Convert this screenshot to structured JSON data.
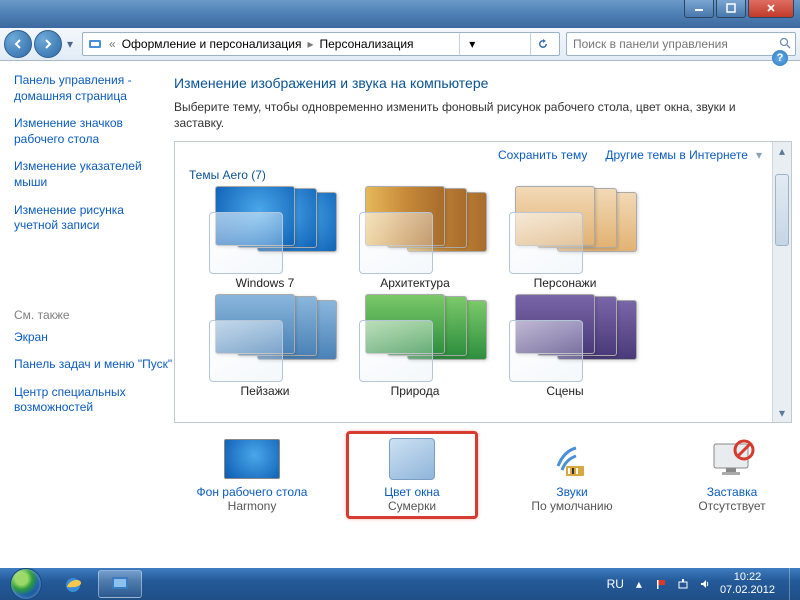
{
  "breadcrumb": {
    "parent": "Оформление и персонализация",
    "current": "Персонализация"
  },
  "search": {
    "placeholder": "Поиск в панели управления"
  },
  "sidebar": {
    "links": [
      "Панель управления - домашняя страница",
      "Изменение значков рабочего стола",
      "Изменение указателей мыши",
      "Изменение рисунка учетной записи"
    ],
    "see_also": "См. также",
    "bottom": [
      "Экран",
      "Панель задач и меню \"Пуск\"",
      "Центр специальных возможностей"
    ]
  },
  "page": {
    "title": "Изменение изображения и звука на компьютере",
    "subtitle": "Выберите тему, чтобы одновременно изменить фоновый рисунок рабочего стола, цвет окна, звуки и заставку."
  },
  "themes_header": {
    "save": "Сохранить тему",
    "online": "Другие темы в Интернете"
  },
  "group_label": "Темы Aero (7)",
  "themes": [
    {
      "name": "Windows 7"
    },
    {
      "name": "Архитектура"
    },
    {
      "name": "Персонажи"
    },
    {
      "name": "Пейзажи"
    },
    {
      "name": "Природа"
    },
    {
      "name": "Сцены"
    }
  ],
  "footer": [
    {
      "link": "Фон рабочего стола",
      "sub": "Harmony"
    },
    {
      "link": "Цвет окна",
      "sub": "Сумерки"
    },
    {
      "link": "Звуки",
      "sub": "По умолчанию"
    },
    {
      "link": "Заставка",
      "sub": "Отсутствует"
    }
  ],
  "tray": {
    "lang": "RU"
  },
  "clock": {
    "time": "10:22",
    "date": "07.02.2012"
  }
}
